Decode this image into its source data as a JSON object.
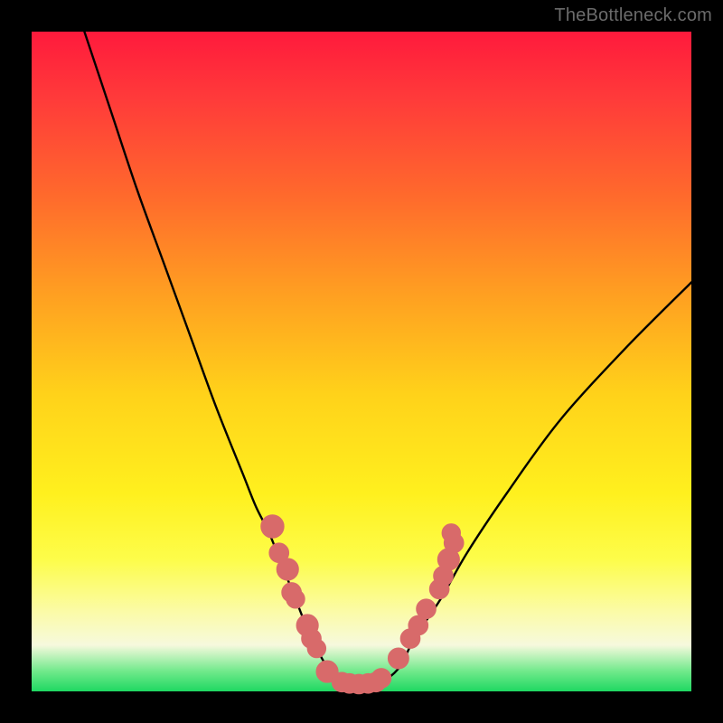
{
  "watermark": "TheBottleneck.com",
  "colors": {
    "frame": "#000000",
    "curve": "#000000",
    "dots": "#d86a6a"
  },
  "chart_data": {
    "type": "line",
    "title": "",
    "xlabel": "",
    "ylabel": "",
    "xlim": [
      0,
      100
    ],
    "ylim": [
      0,
      100
    ],
    "legend": false,
    "grid": false,
    "series": [
      {
        "name": "bottleneck-curve",
        "x": [
          8,
          12,
          16,
          20,
          24,
          28,
          32,
          34,
          36,
          38,
          40,
          42,
          44,
          46,
          48,
          50,
          52,
          54,
          56,
          58,
          62,
          66,
          72,
          80,
          90,
          100
        ],
        "y": [
          100,
          88,
          76,
          65,
          54,
          43,
          33,
          28,
          24,
          19,
          14,
          9,
          5,
          2,
          1,
          1,
          1,
          2,
          4,
          8,
          14,
          21,
          30,
          41,
          52,
          62
        ]
      }
    ],
    "dots": [
      {
        "x": 36.5,
        "y": 25.0,
        "r": 1.4
      },
      {
        "x": 37.5,
        "y": 21.0,
        "r": 1.1
      },
      {
        "x": 38.8,
        "y": 18.5,
        "r": 1.3
      },
      {
        "x": 39.4,
        "y": 15.0,
        "r": 1.1
      },
      {
        "x": 40.0,
        "y": 14.0,
        "r": 1.0
      },
      {
        "x": 41.8,
        "y": 10.0,
        "r": 1.3
      },
      {
        "x": 42.4,
        "y": 8.0,
        "r": 1.1
      },
      {
        "x": 43.2,
        "y": 6.5,
        "r": 1.0
      },
      {
        "x": 44.8,
        "y": 3.0,
        "r": 1.3
      },
      {
        "x": 47.0,
        "y": 1.4,
        "r": 1.1
      },
      {
        "x": 48.2,
        "y": 1.2,
        "r": 1.1
      },
      {
        "x": 49.6,
        "y": 1.1,
        "r": 1.1
      },
      {
        "x": 51.0,
        "y": 1.2,
        "r": 1.1
      },
      {
        "x": 52.2,
        "y": 1.4,
        "r": 1.1
      },
      {
        "x": 53.0,
        "y": 2.0,
        "r": 1.1
      },
      {
        "x": 55.6,
        "y": 5.0,
        "r": 1.2
      },
      {
        "x": 57.4,
        "y": 8.0,
        "r": 1.1
      },
      {
        "x": 58.6,
        "y": 10.0,
        "r": 1.1
      },
      {
        "x": 59.8,
        "y": 12.5,
        "r": 1.1
      },
      {
        "x": 61.8,
        "y": 15.5,
        "r": 1.1
      },
      {
        "x": 62.4,
        "y": 17.5,
        "r": 1.1
      },
      {
        "x": 63.2,
        "y": 20.0,
        "r": 1.3
      },
      {
        "x": 64.0,
        "y": 22.5,
        "r": 1.1
      },
      {
        "x": 63.6,
        "y": 24.0,
        "r": 1.0
      }
    ],
    "annotations": []
  }
}
